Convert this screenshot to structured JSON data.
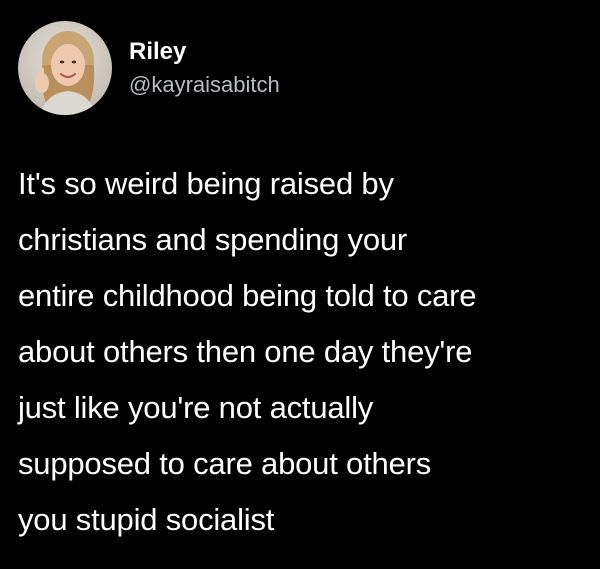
{
  "user": {
    "display_name": "Riley",
    "handle": "@kayraisabitch",
    "avatar_icon": "profile-photo-avatar"
  },
  "tweet": {
    "lines": [
      "It's so weird being raised by",
      "christians and spending your",
      "entire childhood being told to care",
      "about others then one day they're",
      "just like you're not actually",
      "supposed to care about others",
      "you stupid socialist"
    ]
  },
  "colors": {
    "background": "#000000",
    "name_text": "#ffffff",
    "handle_text": "#b9bcc1",
    "body_text": "#ffffff"
  }
}
